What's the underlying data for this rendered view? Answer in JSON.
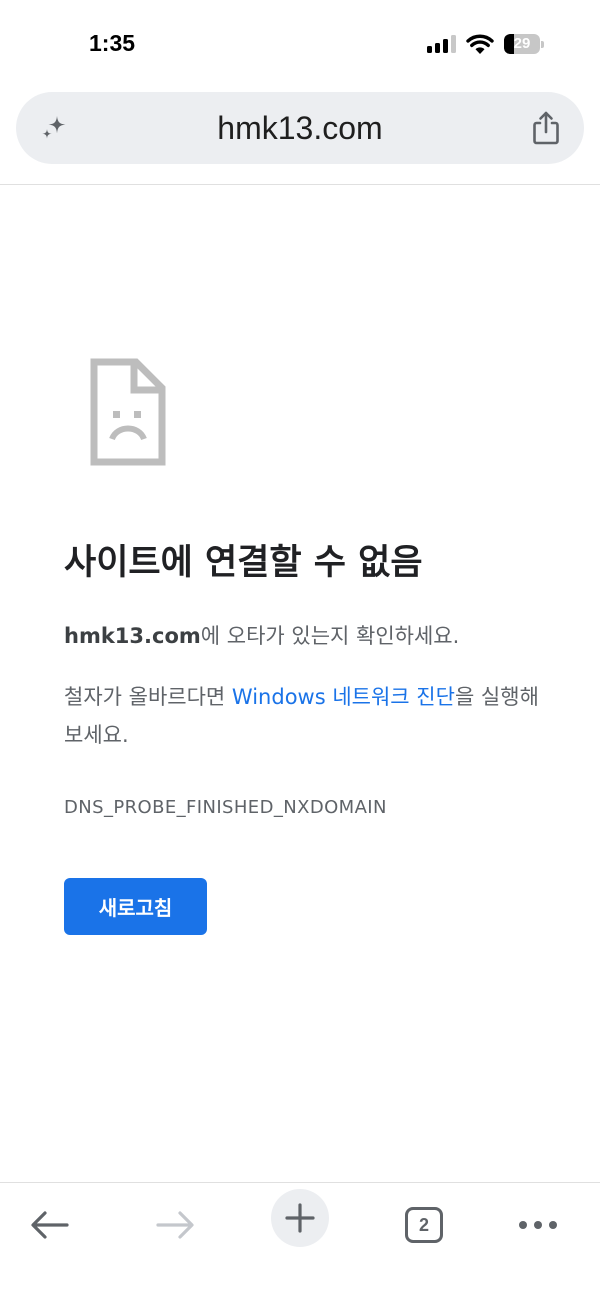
{
  "status_bar": {
    "time": "1:35",
    "battery_level": "29",
    "battery_fraction": 0.29
  },
  "omnibox": {
    "url": "hmk13.com"
  },
  "error_page": {
    "title": "사이트에 연결할 수 없음",
    "domain": "hmk13.com",
    "typo_text": "에 오타가 있는지 확인하세요.",
    "diag_prefix": "철자가 올바르다면 ",
    "diag_link": "Windows 네트워크 진단",
    "diag_suffix": "을 실행해 보세요.",
    "error_code": "DNS_PROBE_FINISHED_NXDOMAIN",
    "reload_label": "새로고침"
  },
  "bottom_bar": {
    "tab_count": "2"
  },
  "colors": {
    "accent": "#1a73e8",
    "icon_gray": "#5f6368",
    "omnibox_bg": "#eceef1"
  }
}
